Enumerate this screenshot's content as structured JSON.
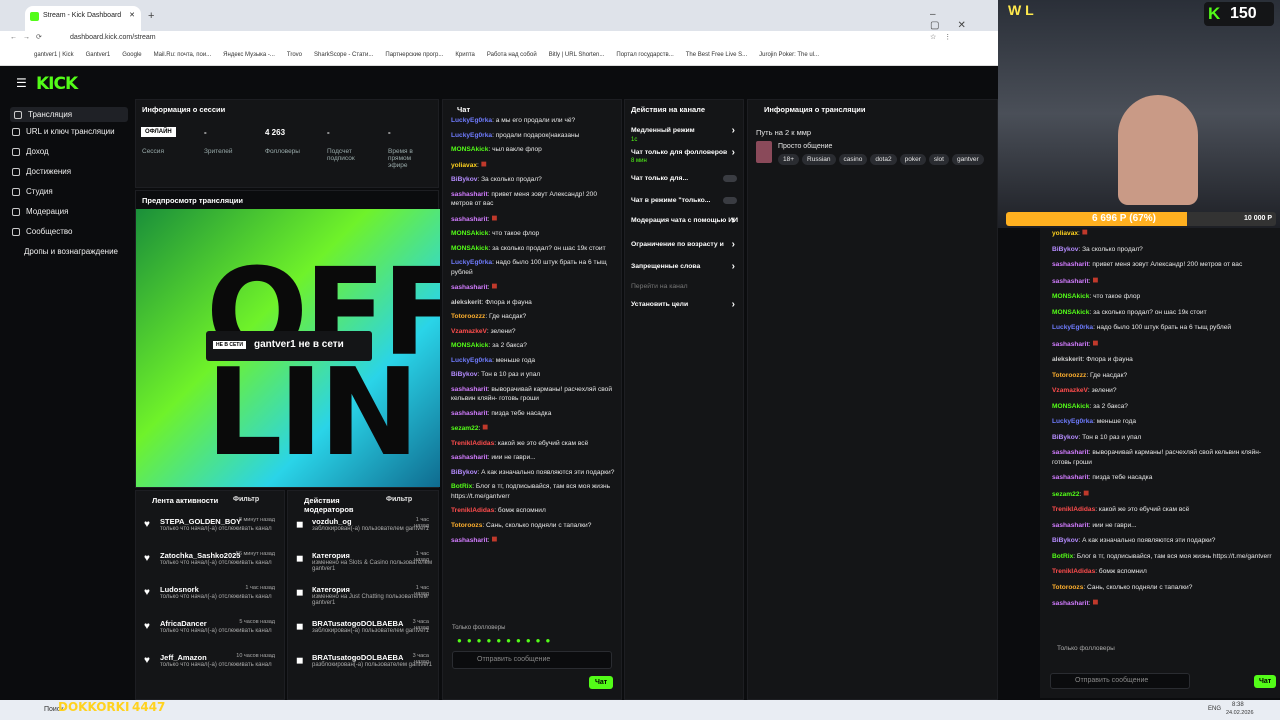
{
  "browser": {
    "tab_title": "Stream - Kick Dashboard",
    "url": "dashboard.kick.com/stream",
    "bookmarks": [
      "gantver1 | Kick",
      "Gantver1",
      "Google",
      "Mail.Ru: почта, пои...",
      "Яндекс Музыка -...",
      "Trovo",
      "SharkScope - Стати...",
      "Партнерские прогр...",
      "Крипта",
      "Работа над собой",
      "Bitly | URL Shorten...",
      "Портал государств...",
      "The Best Free Live S...",
      "Jurojin Poker: The ul..."
    ]
  },
  "brand": "KICK",
  "sidebar": {
    "items": [
      {
        "label": "Трансляция"
      },
      {
        "label": "URL и ключ трансляции"
      },
      {
        "label": "Доход"
      },
      {
        "label": "Достижения"
      },
      {
        "label": "Студия"
      },
      {
        "label": "Модерация"
      },
      {
        "label": "Сообщество"
      },
      {
        "label": "Дропы и вознаграждение"
      }
    ]
  },
  "session": {
    "title": "Информация о сессии",
    "status": "ОФЛАЙН",
    "session_label": "Сессия",
    "viewers_value": "-",
    "viewers_label": "Зрителей",
    "followers_value": "4 263",
    "followers_label": "Фолловеры",
    "subs_value": "-",
    "subs_label": "Подсчет подписок",
    "time_value": "-",
    "time_label": "Время в прямом эфире"
  },
  "preview": {
    "title": "Предпросмотр трансляции",
    "badge": "НЕ В СЕТИ",
    "offline_text": "gantver1 не в сети",
    "art_text": "OFF LIN"
  },
  "activity": {
    "title": "Лента активности",
    "filter": "Фильтр",
    "items": [
      {
        "name": "STEPA_GOLDEN_BOY",
        "time": "8 минут назад",
        "desc": "только что начал(-а) отслеживать канал"
      },
      {
        "name": "Zatochka_Sashko2025",
        "time": "56 минут назад",
        "desc": "только что начал(-а) отслеживать канал"
      },
      {
        "name": "Ludosnork",
        "time": "1 час назад",
        "desc": "только что начал(-а) отслеживать канал"
      },
      {
        "name": "AfricaDancer",
        "time": "5 часов назад",
        "desc": "только что начал(-а) отслеживать канал"
      },
      {
        "name": "Jeff_Amazon",
        "time": "10 часов назад",
        "desc": "только что начал(-а) отслеживать канал"
      }
    ]
  },
  "modactions": {
    "title": "Действия модераторов",
    "filter": "Фильтр",
    "items": [
      {
        "name": "vozduh_og",
        "time": "1 час назад",
        "desc": "заблокирован(-а) пользователем gantver1"
      },
      {
        "name": "Категория",
        "time": "1 час назад",
        "desc": "изменено на Slots & Casino пользователем gantver1"
      },
      {
        "name": "Категория",
        "time": "1 час назад",
        "desc": "изменено на Just Chatting пользователем gantver1"
      },
      {
        "name": "BRATusatogoDOLBAEBA",
        "time": "3 часа назад",
        "desc": "заблокирован(-а) пользователем gantver1"
      },
      {
        "name": "BRATusatogoDOLBAEBA",
        "time": "3 часа назад",
        "desc": "разблокирован(-а) пользователем gantver1"
      }
    ]
  },
  "chat": {
    "title": "Чат",
    "messages": [
      {
        "user": "LuckyEg0rka",
        "color": "#6f7cff",
        "text": "а мы его продали или чё?"
      },
      {
        "user": "LuckyEg0rka",
        "color": "#6f7cff",
        "text": "продали подарок(наказаны"
      },
      {
        "user": "MONSAkick",
        "color": "#53fc18",
        "text": "чыл вакле флор"
      },
      {
        "user": "yoliavax",
        "color": "#ffd21f",
        "text": ""
      },
      {
        "user": "BiBykov",
        "color": "#b58cff",
        "text": "За сколько продал?"
      },
      {
        "user": "sashasharit",
        "color": "#d27cff",
        "text": "привет меня зовут Александр! 200 метров от вас"
      },
      {
        "user": "sashasharit",
        "color": "#d27cff",
        "text": ""
      },
      {
        "user": "MONSAkick",
        "color": "#53fc18",
        "text": "что такое флор"
      },
      {
        "user": "MONSAkick",
        "color": "#53fc18",
        "text": "за сколько продал? он шас 19к стоит"
      },
      {
        "user": "LuckyEg0rka",
        "color": "#6f7cff",
        "text": "надо было 100 штук брать на 6 тыщ рублей"
      },
      {
        "user": "sashasharit",
        "color": "#d27cff",
        "text": ""
      },
      {
        "user": "alekskerit",
        "color": "#ccc",
        "text": "Флора и фауна"
      },
      {
        "user": "Totoroozzz",
        "color": "#ffb02e",
        "text": "Где насдак?"
      },
      {
        "user": "VzamazkeV",
        "color": "#ff4d4d",
        "text": "зелени?"
      },
      {
        "user": "MONSAkick",
        "color": "#53fc18",
        "text": "за 2 бакса?"
      },
      {
        "user": "LuckyEg0rka",
        "color": "#6f7cff",
        "text": "меньше года"
      },
      {
        "user": "BiBykov",
        "color": "#b58cff",
        "text": "Тон в 10 раз и упал"
      },
      {
        "user": "sashasharit",
        "color": "#d27cff",
        "text": "выворачивай карманы! расчехляй свой кельвин кляйн- готовь гроши"
      },
      {
        "user": "sashasharit",
        "color": "#d27cff",
        "text": "пизда тебе насадка"
      },
      {
        "user": "sezam22",
        "color": "#53fc18",
        "text": ""
      },
      {
        "user": "TreniklAdidas",
        "color": "#ff4d4d",
        "text": "какой же это ебучий скам всё"
      },
      {
        "user": "sashasharit",
        "color": "#d27cff",
        "text": "иии не гаври..."
      },
      {
        "user": "BiBykov",
        "color": "#b58cff",
        "text": "А как изначально появляются эти подарки?"
      },
      {
        "user": "BotRix",
        "color": "#53fc18",
        "text": "Блог в тг, подписывайся, там вся моя жизнь https://t.me/gantverr"
      },
      {
        "user": "TreniklAdidas",
        "color": "#ff4d4d",
        "text": "бомж вспомнил"
      },
      {
        "user": "Totoroozs",
        "color": "#ffb02e",
        "text": "Сань, сколько подняли с тапалки?"
      },
      {
        "user": "sashasharit",
        "color": "#d27cff",
        "text": ""
      }
    ],
    "followers_only": "Только фолловеры",
    "placeholder": "Отправить сообщение",
    "send": "Чат"
  },
  "channel_actions": {
    "title": "Действия на канале",
    "items": [
      "Медленный режим",
      "Чат только для фолловеров",
      "Чат только для...",
      "Чат в режиме \"только...",
      "Модерация чата с помощью ИИ",
      "Ограничение по возрасту и",
      "Запрещенные слова",
      "Перейти на канал",
      "Установить цели"
    ],
    "slow_value": "1с",
    "follow_value": "8 мин"
  },
  "stream_info": {
    "title": "Информация о трансляции",
    "stream_title": "Путь на 2 к ммр",
    "category": "Просто общение",
    "tags": [
      "18+",
      "Russian",
      "casino",
      "dota2",
      "poker",
      "slot",
      "gantver"
    ]
  },
  "overlay": {
    "wl": "W L",
    "kick_count": "150",
    "goal": "6 696 Р (67%)",
    "goal_target": "10 000 Р",
    "goal_progress": 0.67,
    "bottom_left": "DOKKORKI",
    "bottom_left2": "4447"
  },
  "chat2": {
    "messages": [
      {
        "user": "yoliavax",
        "color": "#ffd21f",
        "text": ""
      },
      {
        "user": "BiBykov",
        "color": "#b58cff",
        "text": "За сколько продал?"
      },
      {
        "user": "sashasharit",
        "color": "#d27cff",
        "text": "привет меня зовут Александр! 200 метров от вас"
      },
      {
        "user": "sashasharit",
        "color": "#d27cff",
        "text": ""
      },
      {
        "user": "MONSAkick",
        "color": "#53fc18",
        "text": "что такое флор"
      },
      {
        "user": "MONSAkick",
        "color": "#53fc18",
        "text": "за сколько продал? он шас 19к стоит"
      },
      {
        "user": "LuckyEg0rka",
        "color": "#6f7cff",
        "text": "надо было 100 штук брать на 6 тыщ рублей"
      },
      {
        "user": "sashasharit",
        "color": "#d27cff",
        "text": ""
      },
      {
        "user": "alekskerit",
        "color": "#ccc",
        "text": "Флора и фауна"
      },
      {
        "user": "Totoroozzz",
        "color": "#ffb02e",
        "text": "Где насдак?"
      },
      {
        "user": "VzamazkeV",
        "color": "#ff4d4d",
        "text": "зелени?"
      },
      {
        "user": "MONSAkick",
        "color": "#53fc18",
        "text": "за 2 бакса?"
      },
      {
        "user": "LuckyEg0rka",
        "color": "#6f7cff",
        "text": "меньше года"
      },
      {
        "user": "BiBykov",
        "color": "#b58cff",
        "text": "Тон в 10 раз и упал"
      },
      {
        "user": "sashasharit",
        "color": "#d27cff",
        "text": "выворачивай карманы! расчехляй свой кельвин кляйн- готовь гроши"
      },
      {
        "user": "sashasharit",
        "color": "#d27cff",
        "text": "пизда тебе насадка"
      },
      {
        "user": "sezam22",
        "color": "#53fc18",
        "text": ""
      },
      {
        "user": "TreniklAdidas",
        "color": "#ff4d4d",
        "text": "какой же это ебучий скам всё"
      },
      {
        "user": "sashasharit",
        "color": "#d27cff",
        "text": "иии не гаври..."
      },
      {
        "user": "BiBykov",
        "color": "#b58cff",
        "text": "А как изначально появляются эти подарки?"
      },
      {
        "user": "BotRix",
        "color": "#53fc18",
        "text": "Блог в тг, подписывайся, там вся моя жизнь https://t.me/gantverr"
      },
      {
        "user": "TreniklAdidas",
        "color": "#ff4d4d",
        "text": "бомж вспомнил"
      },
      {
        "user": "Totoroozs",
        "color": "#ffb02e",
        "text": "Сань, сколько подняли с тапалки?"
      },
      {
        "user": "sashasharit",
        "color": "#d27cff",
        "text": ""
      }
    ],
    "followers_only": "Только фолловеры",
    "placeholder": "Отправить сообщение",
    "send": "Чат"
  },
  "taskbar": {
    "search": "Поиск",
    "time": "8:38",
    "date": "24.02.2026",
    "lang": "ENG"
  }
}
